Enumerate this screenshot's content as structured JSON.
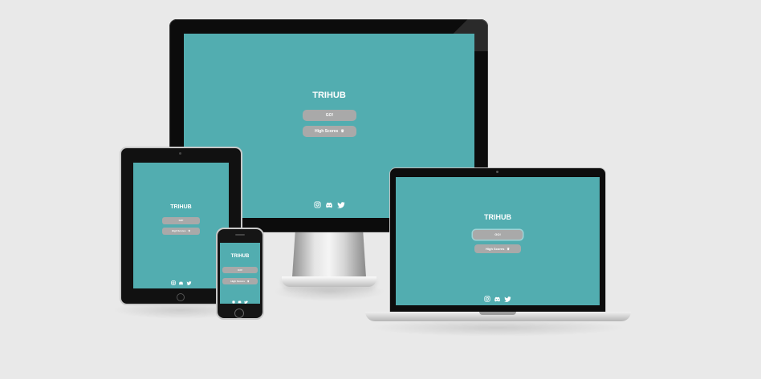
{
  "app": {
    "title": "TRIHUB",
    "go_label": "GO!",
    "highscores_label": "High Scores",
    "crown_glyph": "♛",
    "colors": {
      "screen_bg": "#52adb0",
      "button_bg": "#a9a9a9",
      "text": "#ffffff",
      "page_bg": "#e9e9e9"
    }
  },
  "social_icons": [
    "instagram-icon",
    "discord-icon",
    "twitter-icon"
  ],
  "devices": [
    "desktop-monitor",
    "tablet",
    "laptop",
    "phone"
  ]
}
